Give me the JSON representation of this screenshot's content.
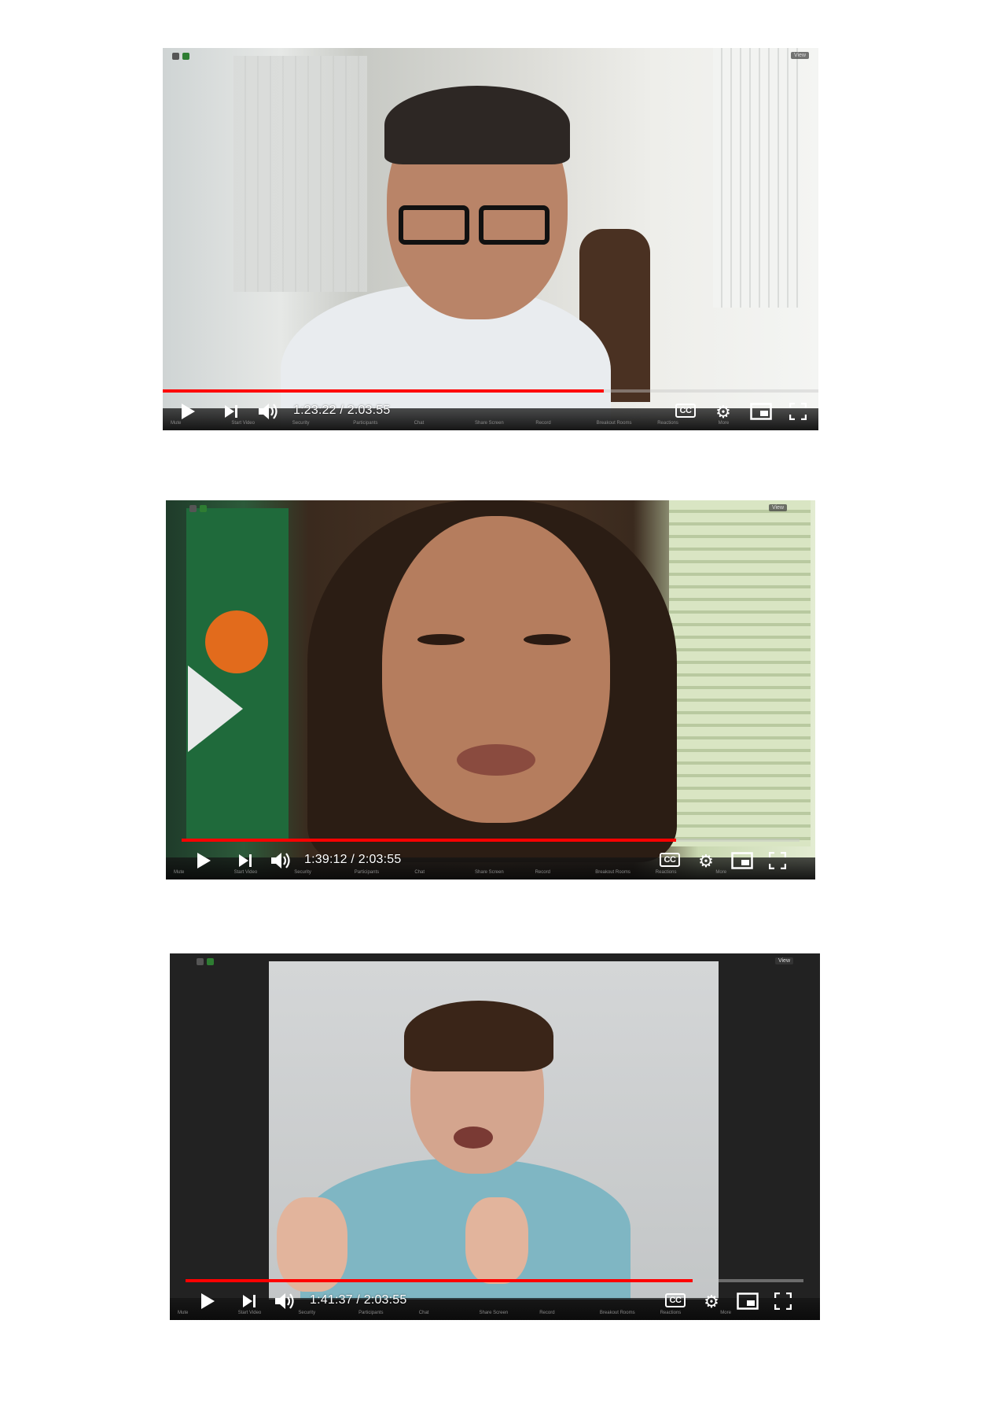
{
  "colors": {
    "progress": "#ff0000",
    "track": "#c8c8c8",
    "controls": "#ffffff"
  },
  "zoom_toolbar_labels": [
    "Mute",
    "Start Video",
    "Security",
    "Participants",
    "Chat",
    "Share Screen",
    "Record",
    "Breakout Rooms",
    "Reactions",
    "More"
  ],
  "players": [
    {
      "time": "1:23:22 / 2:03:55",
      "progress": 0.673,
      "cc_label": "CC",
      "view_label": "View"
    },
    {
      "time": "1:39:12 / 2:03:55",
      "progress": 0.8,
      "cc_label": "CC",
      "view_label": "View"
    },
    {
      "time": "1:41:37 / 2:03:55",
      "progress": 0.82,
      "cc_label": "CC",
      "view_label": "View"
    }
  ],
  "icons": [
    "play-icon",
    "next-icon",
    "volume-icon",
    "captions-icon",
    "settings-icon",
    "miniplayer-icon",
    "fullscreen-icon"
  ]
}
